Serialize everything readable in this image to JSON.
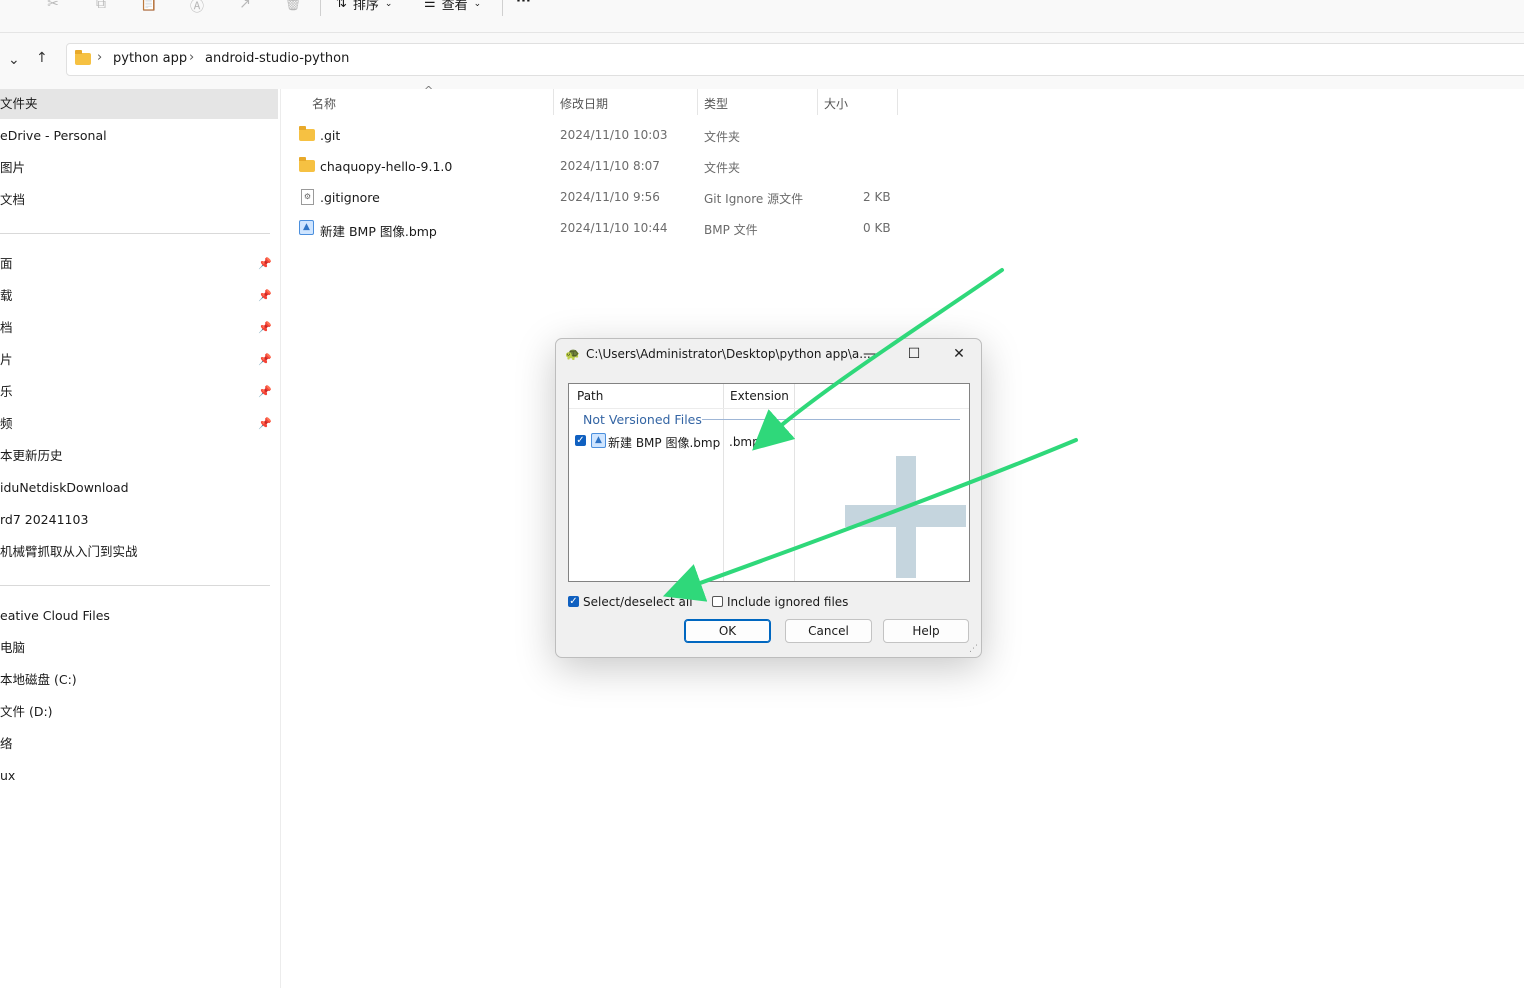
{
  "toolbar": {
    "icons": [
      "cut-icon",
      "copy-icon",
      "paste-icon",
      "rename-icon",
      "share-icon",
      "delete-icon"
    ],
    "sort_label": "排序",
    "view_label": "查看",
    "more_label": "···"
  },
  "breadcrumb": [
    "python app",
    "android-studio-python"
  ],
  "sidebar": {
    "items": [
      {
        "label": "文件夹",
        "selected": true
      },
      {
        "label": "eDrive - Personal"
      },
      {
        "label": "图片"
      },
      {
        "label": "文档"
      },
      {
        "label": "面",
        "pinned": true
      },
      {
        "label": "载",
        "pinned": true
      },
      {
        "label": "档",
        "pinned": true
      },
      {
        "label": "片",
        "pinned": true
      },
      {
        "label": "乐",
        "pinned": true
      },
      {
        "label": "频",
        "pinned": true
      },
      {
        "label": "本更新历史"
      },
      {
        "label": "iduNetdiskDownload"
      },
      {
        "label": "rd7 20241103"
      },
      {
        "label": "机械臂抓取从入门到实战"
      },
      {
        "label": "eative Cloud Files"
      },
      {
        "label": "电脑"
      },
      {
        "label": "本地磁盘 (C:)"
      },
      {
        "label": "文件 (D:)"
      },
      {
        "label": "络"
      },
      {
        "label": "ux"
      }
    ]
  },
  "columns": {
    "name": "名称",
    "modified": "修改日期",
    "type": "类型",
    "size": "大小"
  },
  "files": [
    {
      "icon": "folder-icon",
      "name": ".git",
      "modified": "2024/11/10 10:03",
      "type": "文件夹",
      "size": ""
    },
    {
      "icon": "folder-icon",
      "name": "chaquopy-hello-9.1.0",
      "modified": "2024/11/10 8:07",
      "type": "文件夹",
      "size": ""
    },
    {
      "icon": "gitignore-file-icon",
      "name": ".gitignore",
      "modified": "2024/11/10 9:56",
      "type": "Git Ignore 源文件",
      "size": "2 KB"
    },
    {
      "icon": "image-file-icon",
      "name": "新建 BMP 图像.bmp",
      "modified": "2024/11/10 10:44",
      "type": "BMP 文件",
      "size": "0 KB"
    }
  ],
  "dialog": {
    "title": "C:\\Users\\Administrator\\Desktop\\python app\\a...",
    "list_headers": {
      "path": "Path",
      "extension": "Extension"
    },
    "group_label": "Not Versioned Files",
    "rows": [
      {
        "checked": true,
        "path": "新建 BMP 图像.bmp",
        "extension": ".bmp"
      }
    ],
    "select_all_label": "Select/deselect all",
    "select_all_checked": true,
    "include_ignored_label": "Include ignored files",
    "include_ignored_checked": false,
    "buttons": {
      "ok": "OK",
      "cancel": "Cancel",
      "help": "Help"
    },
    "controls": {
      "minimize": "—",
      "maximize": "☐",
      "close": "✕"
    }
  },
  "annotation": {
    "arrow_color": "#2fd87a"
  }
}
